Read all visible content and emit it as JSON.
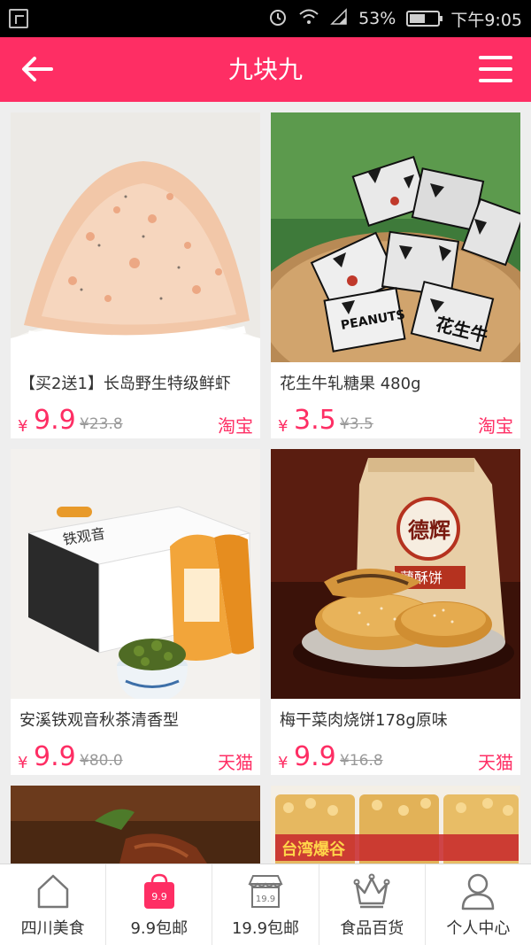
{
  "status_bar": {
    "battery": "53%",
    "time": "下午9:05"
  },
  "header": {
    "title": "九块九"
  },
  "colors": {
    "accent": "#fe2e64",
    "old_price": "#999999"
  },
  "products": [
    {
      "name": "【买2送1】长岛野生特级鲜虾",
      "yen": "¥",
      "price": "9.9",
      "old_price": "¥23.8",
      "shop": "淘宝"
    },
    {
      "name": "花生牛轧糖果 480g",
      "yen": "¥",
      "price": "3.5",
      "old_price": "¥3.5",
      "shop": "淘宝"
    },
    {
      "name": "安溪铁观音秋茶清香型",
      "yen": "¥",
      "price": "9.9",
      "old_price": "¥80.0",
      "shop": "天猫"
    },
    {
      "name": "梅干菜肉烧饼178g原味",
      "yen": "¥",
      "price": "9.9",
      "old_price": "¥16.8",
      "shop": "天猫"
    }
  ],
  "image_texts": {
    "peanut_wrapper": "PEANUTS",
    "candy_brand": "花生牛",
    "tea_brand": "铁观音",
    "biscuit_brand": "德辉",
    "biscuit_sub": "薄酥饼",
    "popcorn_brand": "台湾爆谷"
  },
  "tabs": [
    {
      "label": "四川美食",
      "icon": "home-icon"
    },
    {
      "label": "9.9包邮",
      "icon": "bag-icon",
      "badge": "9.9"
    },
    {
      "label": "19.9包邮",
      "icon": "shop-icon",
      "badge": "19.9"
    },
    {
      "label": "食品百货",
      "icon": "crown-icon"
    },
    {
      "label": "个人中心",
      "icon": "user-icon"
    }
  ]
}
